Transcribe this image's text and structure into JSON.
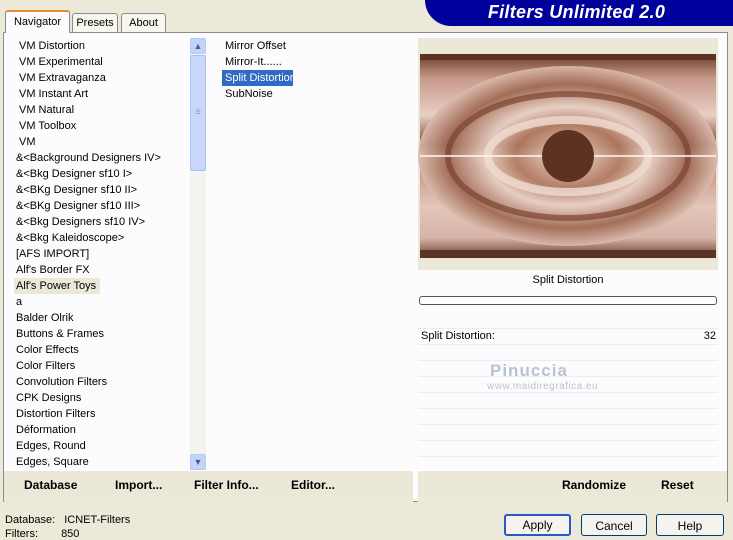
{
  "banner": {
    "title": "Filters Unlimited 2.0"
  },
  "tabs": [
    {
      "label": "Navigator"
    },
    {
      "label": "Presets"
    },
    {
      "label": "About"
    }
  ],
  "categories": [
    "VM Distortion",
    "VM Experimental",
    "VM Extravaganza",
    "VM Instant Art",
    "VM Natural",
    "VM Toolbox",
    "VM",
    "&<Background Designers IV>",
    "&<Bkg Designer sf10 I>",
    "&<BKg Designer sf10 II>",
    "&<BKg Designer sf10 III>",
    "&<Bkg Designers sf10 IV>",
    "&<Bkg Kaleidoscope>",
    "[AFS IMPORT]",
    "Alf's Border FX",
    "Alf's Power Toys",
    "a",
    "Balder Olrik",
    "Buttons & Frames",
    "Color Effects",
    "Color Filters",
    "Convolution Filters",
    "CPK Designs",
    "Distortion Filters",
    "Déformation",
    "Edges, Round",
    "Edges, Square"
  ],
  "selected_category": "Alf's Power Toys",
  "filters": [
    "Mirror Offset",
    "Mirror-It......",
    "Split Distortion",
    "SubNoise"
  ],
  "selected_filter": "Split Distortion",
  "left_buttons": {
    "database": "Database",
    "import": "Import...",
    "filter_info": "Filter Info...",
    "editor": "Editor..."
  },
  "right_buttons": {
    "randomize": "Randomize",
    "reset": "Reset"
  },
  "preview": {
    "filter_name": "Split Distortion",
    "colors": {
      "outer": "#5a3322",
      "pink": "#d8b4a8",
      "center": "#5e3220"
    }
  },
  "params": [
    {
      "label": "Split Distortion:",
      "value": "32"
    }
  ],
  "watermark": {
    "line1": "Pinuccia",
    "line2": "www.maidiregrafica.eu"
  },
  "status": {
    "database_label": "Database:",
    "database_value": "ICNET-Filters",
    "filters_label": "Filters:",
    "filters_value": "850"
  },
  "dialog_buttons": {
    "apply": "Apply",
    "cancel": "Cancel",
    "help": "Help"
  }
}
